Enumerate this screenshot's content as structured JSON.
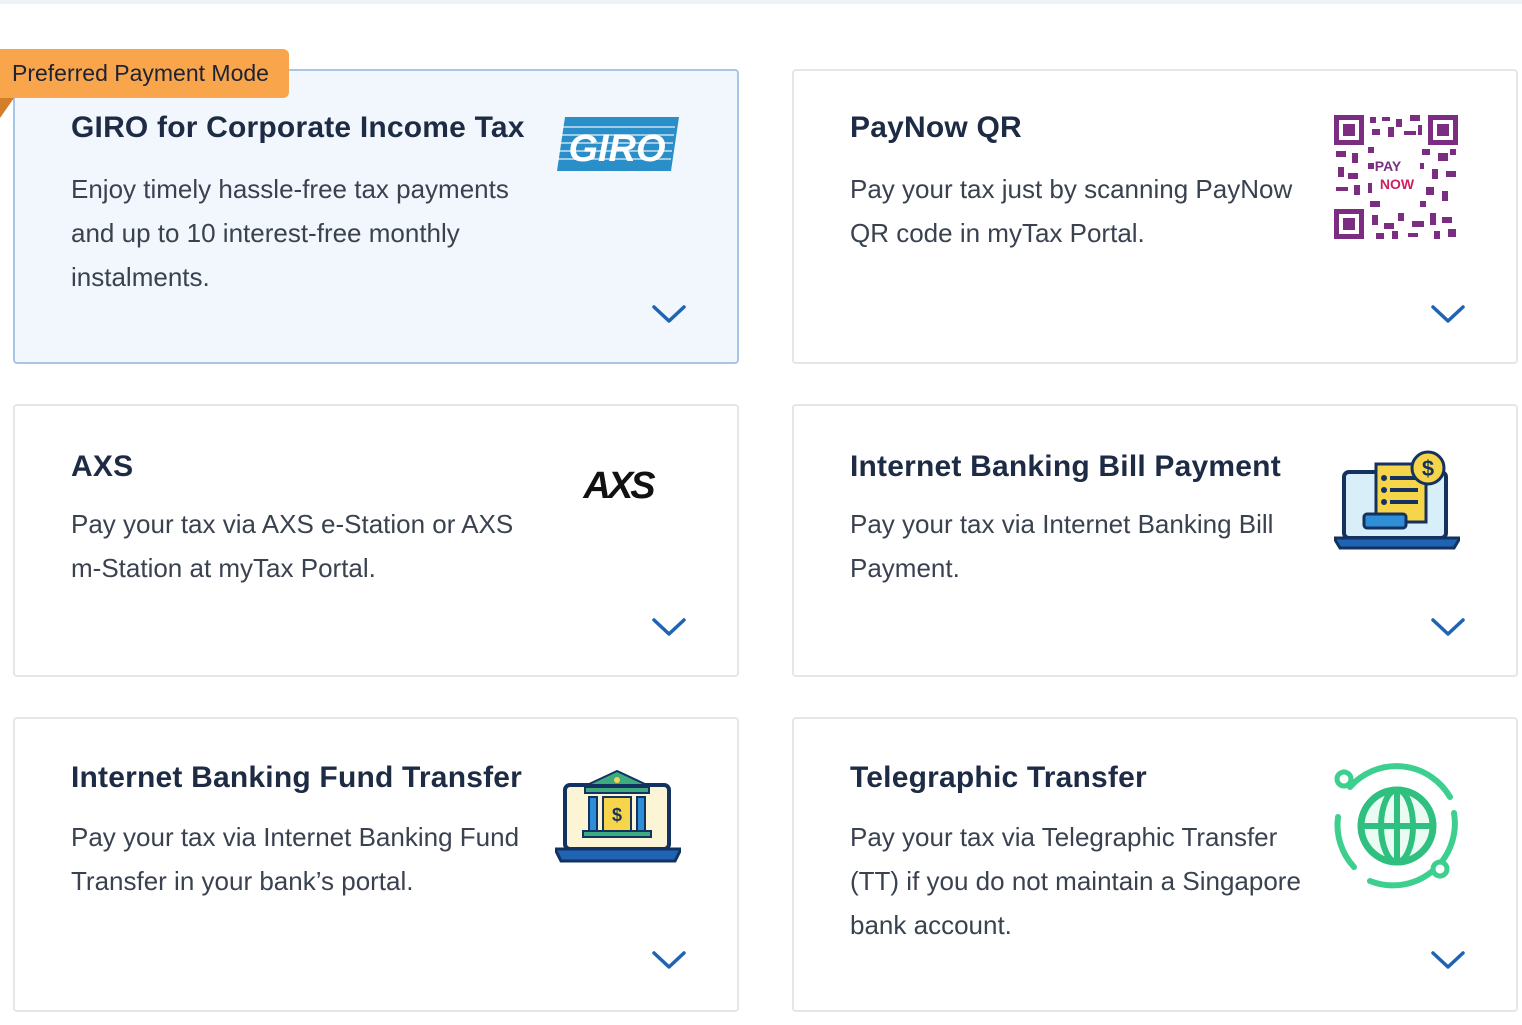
{
  "badge": {
    "label": "Preferred Payment Mode"
  },
  "cards": [
    {
      "title": "GIRO for Corporate Income Tax",
      "desc": "Enjoy timely hassle-free tax payments and up to 10 interest-free monthly instalments.",
      "logo": "giro-logo",
      "logo_text": "GIRO"
    },
    {
      "title": "PayNow QR",
      "desc": "Pay your tax just by scanning PayNow QR code in myTax Portal.",
      "logo": "paynow-qr-code",
      "logo_text_top": "PAY",
      "logo_text_bottom": "NOW"
    },
    {
      "title": "AXS",
      "desc": "Pay your tax via AXS e-Station or AXS m-Station at myTax Portal.",
      "logo": "axs-logo",
      "logo_text": "AXS"
    },
    {
      "title": "Internet Banking Bill Payment",
      "desc": "Pay your tax via Internet Banking Bill Payment.",
      "logo": "laptop-bill-icon"
    },
    {
      "title": "Internet Banking Fund Transfer",
      "desc": "Pay your tax via Internet Banking Fund Transfer in your bank’s portal.",
      "logo": "bank-laptop-icon"
    },
    {
      "title": "Telegraphic Transfer",
      "desc": "Pay your tax via Telegraphic Transfer (TT) if you do not maintain a Singapore bank account.",
      "logo": "globe-icon"
    }
  ],
  "colors": {
    "title": "#1d2b44",
    "text": "#3a4250",
    "chevron": "#1f64b4",
    "badge": "#f8a54b",
    "preferred_bg": "#f2f7fd",
    "preferred_border": "#a9c6e6"
  }
}
